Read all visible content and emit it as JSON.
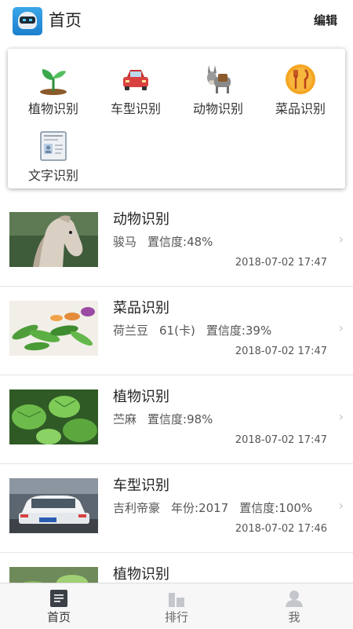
{
  "header": {
    "title": "首页",
    "edit_label": "编辑",
    "logo_icon": "robot-helmet-logo"
  },
  "menu": {
    "items": [
      {
        "label": "植物识别",
        "icon": "plant-sprout-icon",
        "color": "#3aa84a"
      },
      {
        "label": "车型识别",
        "icon": "car-icon",
        "color": "#d94141"
      },
      {
        "label": "动物识别",
        "icon": "donkey-icon",
        "color": "#8b8b8b"
      },
      {
        "label": "菜品识别",
        "icon": "fork-knife-icon",
        "color": "#f5a623"
      },
      {
        "label": "文字识别",
        "icon": "document-id-icon",
        "color": "#7a8ca0"
      }
    ]
  },
  "feed": {
    "rows": [
      {
        "title": "动物识别",
        "details": [
          "骏马",
          "置信度:48%"
        ],
        "time": "2018-07-02 17:47",
        "thumb": "horse-photo"
      },
      {
        "title": "菜品识别",
        "details": [
          "荷兰豆",
          "61(卡)",
          "置信度:39%"
        ],
        "time": "2018-07-02 17:47",
        "thumb": "snow-peas-photo"
      },
      {
        "title": "植物识别",
        "details": [
          "苎麻",
          "置信度:98%"
        ],
        "time": "2018-07-02 17:47",
        "thumb": "ramie-leaves-photo"
      },
      {
        "title": "车型识别",
        "details": [
          "吉利帝豪",
          "年份:2017",
          "置信度:100%"
        ],
        "time": "2018-07-02 17:46",
        "thumb": "white-sedan-photo"
      },
      {
        "title": "植物识别",
        "details": [],
        "time": "",
        "thumb": "plant-photo"
      }
    ],
    "chevron": "›"
  },
  "tabbar": {
    "tabs": [
      {
        "label": "首页",
        "icon": "home-doc-icon",
        "active": true
      },
      {
        "label": "排行",
        "icon": "bar-chart-icon",
        "active": false
      },
      {
        "label": "我",
        "icon": "person-icon",
        "active": false
      }
    ]
  }
}
